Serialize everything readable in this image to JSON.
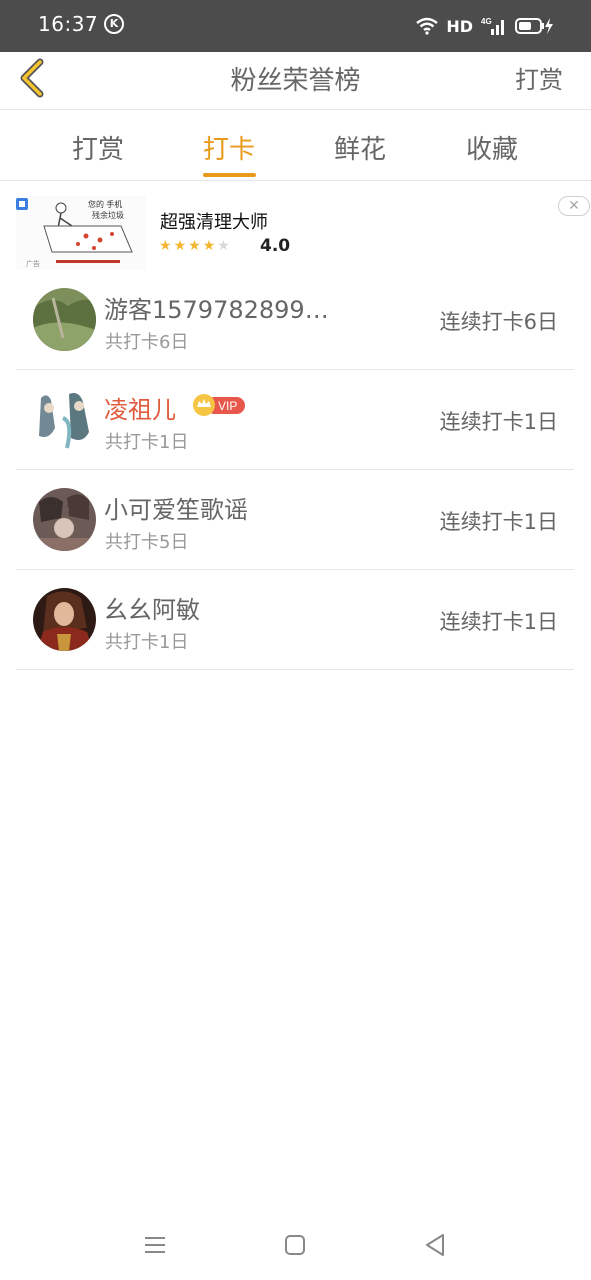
{
  "status_bar": {
    "time": "16:37",
    "k_badge": "K",
    "network": "HD",
    "cell_label": "4G"
  },
  "header": {
    "title": "粉丝荣誉榜",
    "action_label": "打赏",
    "back_icon": "chevron-left-icon"
  },
  "tabs": [
    {
      "label": "打赏",
      "active": false
    },
    {
      "label": "打卡",
      "active": true
    },
    {
      "label": "鲜花",
      "active": false
    },
    {
      "label": "收藏",
      "active": false
    }
  ],
  "ad": {
    "title": "超强清理大师",
    "rating": "4.0",
    "stars": 4,
    "image_text_1": "您的 手机",
    "image_text_2": "残余垃圾",
    "ad_tag": "广告",
    "close_glyph": "✕"
  },
  "list": [
    {
      "name": "游客1579782899…",
      "total": "共打卡6日",
      "streak": "连续打卡6日",
      "vip": false
    },
    {
      "name": "凌祖儿",
      "total": "共打卡1日",
      "streak": "连续打卡1日",
      "vip": true,
      "vip_label": "VIP"
    },
    {
      "name": "小可爱笙歌谣",
      "total": "共打卡5日",
      "streak": "连续打卡1日",
      "vip": false
    },
    {
      "name": "幺幺阿敏",
      "total": "共打卡1日",
      "streak": "连续打卡1日",
      "vip": false
    }
  ],
  "colors": {
    "accent": "#e89a1b",
    "vip_name": "#e05a3d",
    "vip_badge": "#e8574c",
    "status_bar": "#4c4c4c"
  }
}
